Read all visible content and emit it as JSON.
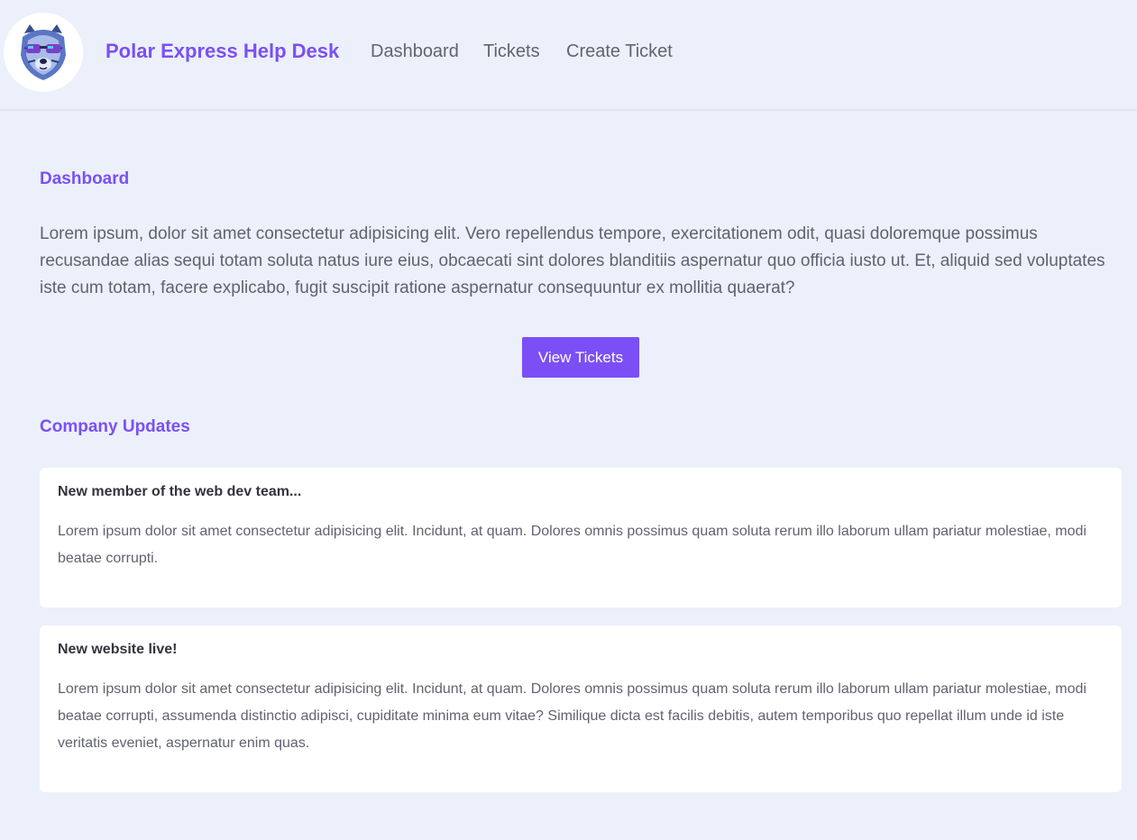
{
  "nav": {
    "brand": "Polar Express Help Desk",
    "links": [
      "Dashboard",
      "Tickets",
      "Create Ticket"
    ]
  },
  "dashboard": {
    "title": "Dashboard",
    "intro": "Lorem ipsum, dolor sit amet consectetur adipisicing elit. Vero repellendus tempore, exercitationem odit, quasi doloremque possimus recusandae alias sequi totam soluta natus iure eius, obcaecati sint dolores blanditiis aspernatur quo officia iusto ut. Et, aliquid sed voluptates iste cum totam, facere explicabo, fugit suscipit ratione aspernatur consequuntur ex mollitia quaerat?",
    "button_label": "View Tickets"
  },
  "updates": {
    "title": "Company Updates",
    "items": [
      {
        "title": "New member of the web dev team...",
        "body": "Lorem ipsum dolor sit amet consectetur adipisicing elit. Incidunt, at quam. Dolores omnis possimus quam soluta rerum illo laborum ullam pariatur molestiae, modi beatae corrupti."
      },
      {
        "title": "New website live!",
        "body": "Lorem ipsum dolor sit amet consectetur adipisicing elit. Incidunt, at quam. Dolores omnis possimus quam soluta rerum illo laborum ullam pariatur molestiae, modi beatae corrupti, assumenda distinctio adipisci, cupiditate minima eum vitae? Similique dicta est facilis debitis, autem temporibus quo repellat illum unde id iste veritatis eveniet, aspernatur enim quas."
      }
    ]
  },
  "colors": {
    "accent": "#7b4ff5",
    "background": "#ebf0fa",
    "card": "#ffffff"
  },
  "icons": {
    "logo": "polar-bear-sunglasses-logo"
  }
}
